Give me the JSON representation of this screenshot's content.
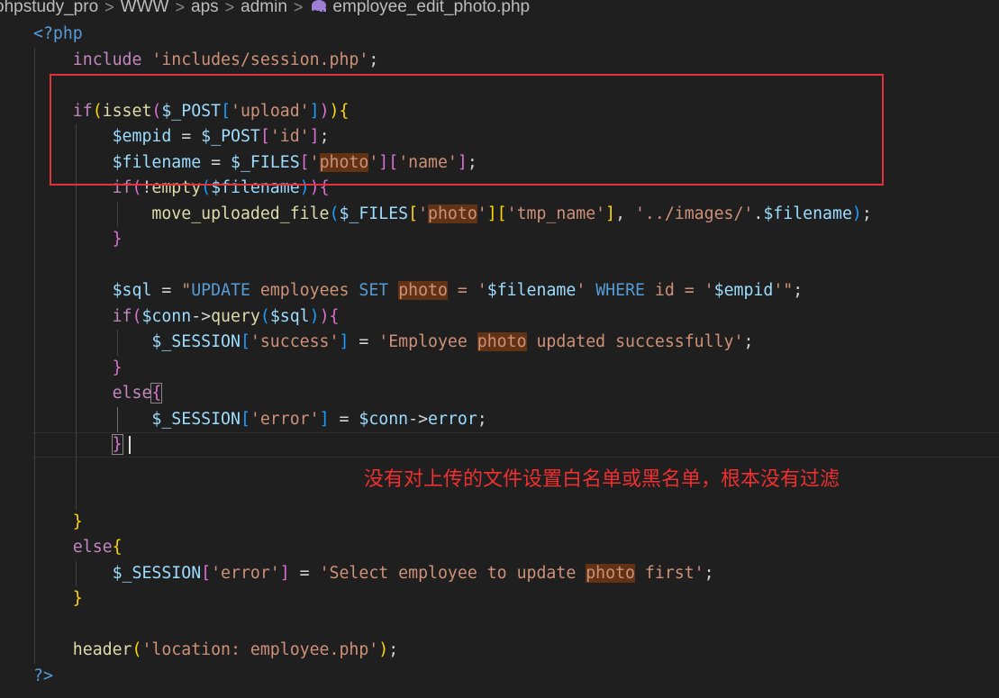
{
  "breadcrumb": {
    "items": [
      "ohpstudy_pro",
      "WWW",
      "aps",
      "admin"
    ],
    "file": "employee_edit_photo.php",
    "file_icon": "php-elephant-icon",
    "separator": ">"
  },
  "editor": {
    "lines": [
      [
        {
          "t": "<?php",
          "c": "kw"
        }
      ],
      [
        {
          "t": "    include ",
          "c": "ctl"
        },
        {
          "t": "'includes/session.php'",
          "c": "str"
        },
        {
          "t": ";",
          "c": "op"
        }
      ],
      [],
      [
        {
          "t": "    if",
          "c": "ctl"
        },
        {
          "t": "(",
          "c": "b1"
        },
        {
          "t": "isset",
          "c": "fn"
        },
        {
          "t": "(",
          "c": "b2"
        },
        {
          "t": "$_POST",
          "c": "var"
        },
        {
          "t": "[",
          "c": "b3"
        },
        {
          "t": "'upload'",
          "c": "str"
        },
        {
          "t": "]",
          "c": "b3"
        },
        {
          "t": ")",
          "c": "b2"
        },
        {
          "t": ")",
          "c": "b1"
        },
        {
          "t": "{",
          "c": "b1"
        }
      ],
      [
        {
          "t": "        $empid",
          "c": "var"
        },
        {
          "t": " = ",
          "c": "op"
        },
        {
          "t": "$_POST",
          "c": "var"
        },
        {
          "t": "[",
          "c": "b2"
        },
        {
          "t": "'id'",
          "c": "str"
        },
        {
          "t": "]",
          "c": "b2"
        },
        {
          "t": ";",
          "c": "op"
        }
      ],
      [
        {
          "t": "        $filename",
          "c": "var"
        },
        {
          "t": " = ",
          "c": "op"
        },
        {
          "t": "$_FILES",
          "c": "var"
        },
        {
          "t": "[",
          "c": "b2"
        },
        {
          "t": "'",
          "c": "str"
        },
        {
          "t": "photo",
          "c": "str",
          "h": 1
        },
        {
          "t": "'",
          "c": "str"
        },
        {
          "t": "]",
          "c": "b2"
        },
        {
          "t": "[",
          "c": "b2"
        },
        {
          "t": "'name'",
          "c": "str"
        },
        {
          "t": "]",
          "c": "b2"
        },
        {
          "t": ";",
          "c": "op"
        }
      ],
      [
        {
          "t": "        if",
          "c": "ctl"
        },
        {
          "t": "(",
          "c": "b2"
        },
        {
          "t": "!",
          "c": "op"
        },
        {
          "t": "empty",
          "c": "fn"
        },
        {
          "t": "(",
          "c": "b3"
        },
        {
          "t": "$filename",
          "c": "var"
        },
        {
          "t": ")",
          "c": "b3"
        },
        {
          "t": ")",
          "c": "b2"
        },
        {
          "t": "{",
          "c": "b2"
        }
      ],
      [
        {
          "t": "            move_uploaded_file",
          "c": "fn"
        },
        {
          "t": "(",
          "c": "b3"
        },
        {
          "t": "$_FILES",
          "c": "var"
        },
        {
          "t": "[",
          "c": "b1"
        },
        {
          "t": "'",
          "c": "str"
        },
        {
          "t": "photo",
          "c": "str",
          "h": 1
        },
        {
          "t": "'",
          "c": "str"
        },
        {
          "t": "]",
          "c": "b1"
        },
        {
          "t": "[",
          "c": "b1"
        },
        {
          "t": "'tmp_name'",
          "c": "str"
        },
        {
          "t": "]",
          "c": "b1"
        },
        {
          "t": ", ",
          "c": "op"
        },
        {
          "t": "'../images/'",
          "c": "str"
        },
        {
          "t": ".",
          "c": "op"
        },
        {
          "t": "$filename",
          "c": "var"
        },
        {
          "t": ")",
          "c": "b3"
        },
        {
          "t": ";",
          "c": "op"
        }
      ],
      [
        {
          "t": "        }",
          "c": "b2"
        }
      ],
      [],
      [
        {
          "t": "        $sql",
          "c": "var"
        },
        {
          "t": " = ",
          "c": "op"
        },
        {
          "t": "\"",
          "c": "str"
        },
        {
          "t": "UPDATE",
          "c": "sqlkw"
        },
        {
          "t": " employees ",
          "c": "str"
        },
        {
          "t": "SET",
          "c": "sqlkw"
        },
        {
          "t": " ",
          "c": "str"
        },
        {
          "t": "photo",
          "c": "str",
          "h": 1
        },
        {
          "t": " = '",
          "c": "str"
        },
        {
          "t": "$filename",
          "c": "var"
        },
        {
          "t": "' ",
          "c": "str"
        },
        {
          "t": "WHERE",
          "c": "sqlkw"
        },
        {
          "t": " id = '",
          "c": "str"
        },
        {
          "t": "$empid",
          "c": "var"
        },
        {
          "t": "'\"",
          "c": "str"
        },
        {
          "t": ";",
          "c": "op"
        }
      ],
      [
        {
          "t": "        if",
          "c": "ctl"
        },
        {
          "t": "(",
          "c": "b2"
        },
        {
          "t": "$conn",
          "c": "var"
        },
        {
          "t": "->",
          "c": "op"
        },
        {
          "t": "query",
          "c": "fn"
        },
        {
          "t": "(",
          "c": "b3"
        },
        {
          "t": "$sql",
          "c": "var"
        },
        {
          "t": ")",
          "c": "b3"
        },
        {
          "t": ")",
          "c": "b2"
        },
        {
          "t": "{",
          "c": "b2"
        }
      ],
      [
        {
          "t": "            $_SESSION",
          "c": "var"
        },
        {
          "t": "[",
          "c": "b3"
        },
        {
          "t": "'success'",
          "c": "str"
        },
        {
          "t": "]",
          "c": "b3"
        },
        {
          "t": " = ",
          "c": "op"
        },
        {
          "t": "'Employee ",
          "c": "str"
        },
        {
          "t": "photo",
          "c": "str",
          "h": 1
        },
        {
          "t": " updated successfully'",
          "c": "str"
        },
        {
          "t": ";",
          "c": "op"
        }
      ],
      [
        {
          "t": "        }",
          "c": "b2"
        }
      ],
      [
        {
          "t": "        else",
          "c": "ctl"
        },
        {
          "t": "{",
          "c": "b2",
          "bm": 1
        }
      ],
      [
        {
          "t": "            $_SESSION",
          "c": "var"
        },
        {
          "t": "[",
          "c": "b3"
        },
        {
          "t": "'error'",
          "c": "str"
        },
        {
          "t": "]",
          "c": "b3"
        },
        {
          "t": " = ",
          "c": "op"
        },
        {
          "t": "$conn",
          "c": "var"
        },
        {
          "t": "->",
          "c": "op"
        },
        {
          "t": "error",
          "c": "var"
        },
        {
          "t": ";",
          "c": "op"
        }
      ],
      [
        {
          "t": "        ",
          "c": "op"
        },
        {
          "t": "}",
          "c": "b2",
          "bm": 1
        }
      ],
      [],
      [],
      [
        {
          "t": "    }",
          "c": "b1"
        }
      ],
      [
        {
          "t": "    else",
          "c": "ctl"
        },
        {
          "t": "{",
          "c": "b1"
        }
      ],
      [
        {
          "t": "        $_SESSION",
          "c": "var"
        },
        {
          "t": "[",
          "c": "b2"
        },
        {
          "t": "'error'",
          "c": "str"
        },
        {
          "t": "]",
          "c": "b2"
        },
        {
          "t": " = ",
          "c": "op"
        },
        {
          "t": "'Select employee to update ",
          "c": "str"
        },
        {
          "t": "photo",
          "c": "str",
          "h": 1
        },
        {
          "t": " first'",
          "c": "str"
        },
        {
          "t": ";",
          "c": "op"
        }
      ],
      [
        {
          "t": "    }",
          "c": "b1"
        }
      ],
      [],
      [
        {
          "t": "    header",
          "c": "fn"
        },
        {
          "t": "(",
          "c": "b1"
        },
        {
          "t": "'location: employee.php'",
          "c": "str"
        },
        {
          "t": ")",
          "c": "b1"
        },
        {
          "t": ";",
          "c": "op"
        }
      ],
      [
        {
          "t": "?>",
          "c": "kw"
        }
      ]
    ]
  },
  "annotation": {
    "text": "没有对上传的文件设置白名单或黑名单，根本没有过滤",
    "color": "#ee3030"
  },
  "colors": {
    "background": "#1f1f1f",
    "highlight_box": "#e0333a",
    "word_highlight": "#613214"
  }
}
